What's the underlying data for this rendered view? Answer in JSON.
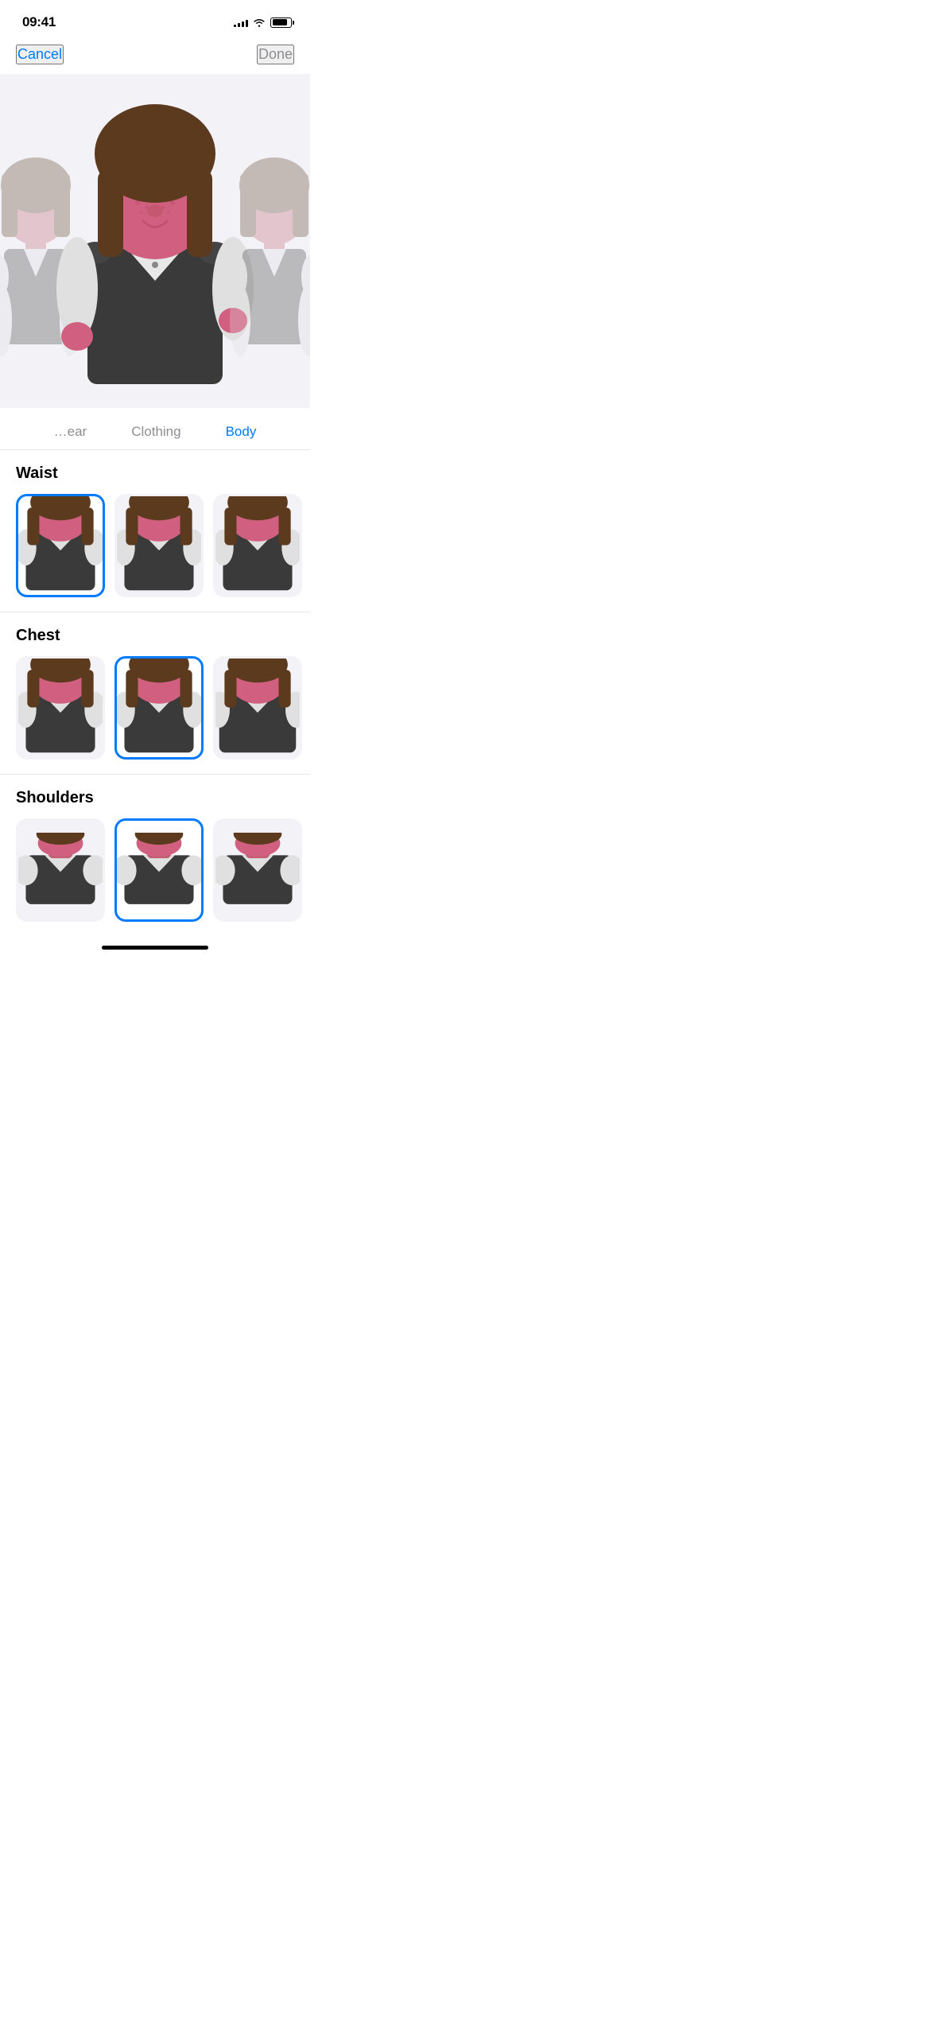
{
  "statusBar": {
    "time": "09:41",
    "signal": [
      3,
      5,
      7,
      9,
      11
    ],
    "battery": 85
  },
  "nav": {
    "cancel": "Cancel",
    "done": "Done"
  },
  "tabs": [
    {
      "id": "headwear",
      "label": "…ear",
      "active": false
    },
    {
      "id": "clothing",
      "label": "Clothing",
      "active": false
    },
    {
      "id": "body",
      "label": "Body",
      "active": true
    }
  ],
  "sections": [
    {
      "id": "waist",
      "title": "Waist",
      "items": [
        {
          "id": "waist-1",
          "selected": true
        },
        {
          "id": "waist-2",
          "selected": false
        },
        {
          "id": "waist-3",
          "selected": false
        }
      ]
    },
    {
      "id": "chest",
      "title": "Chest",
      "items": [
        {
          "id": "chest-1",
          "selected": false
        },
        {
          "id": "chest-2",
          "selected": true
        },
        {
          "id": "chest-3",
          "selected": false
        }
      ]
    },
    {
      "id": "shoulders",
      "title": "Shoulders",
      "items": [
        {
          "id": "shoulders-1",
          "selected": false
        },
        {
          "id": "shoulders-2",
          "selected": true
        },
        {
          "id": "shoulders-3",
          "selected": false
        }
      ]
    }
  ],
  "colors": {
    "accent": "#007AFF",
    "skin": "#E8A0B4",
    "hair": "#5C3A1E",
    "vest": "#3A3A3A",
    "shirt": "#E8E8E8",
    "faceColor": "#D16080"
  }
}
